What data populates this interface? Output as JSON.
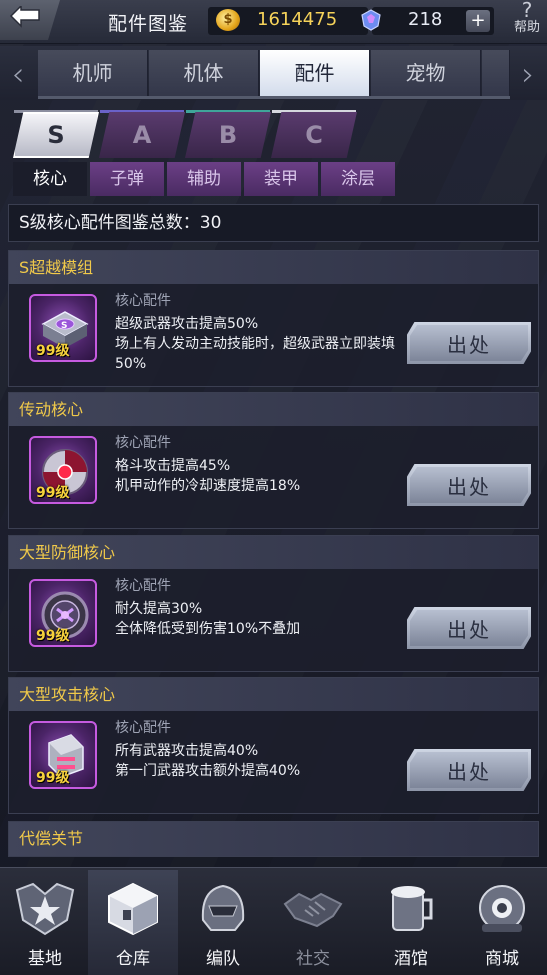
{
  "header": {
    "title": "配件图鉴",
    "gold": "1614475",
    "gems": "218",
    "plus_label": "+",
    "help_label": "帮助",
    "help_mark": "?"
  },
  "main_tabs": [
    {
      "label": "机师",
      "active": false
    },
    {
      "label": "机体",
      "active": false
    },
    {
      "label": "配件",
      "active": true
    },
    {
      "label": "宠物",
      "active": false
    }
  ],
  "grade_tabs": [
    {
      "label": "S",
      "active": true,
      "line_color": "#8c8fa0"
    },
    {
      "label": "A",
      "active": false,
      "line_color": "#6a62c9"
    },
    {
      "label": "B",
      "active": false,
      "line_color": "#3fa59a"
    },
    {
      "label": "C",
      "active": false,
      "line_color": "#d5d7de"
    }
  ],
  "sub_tabs": [
    {
      "label": "核心",
      "active": true
    },
    {
      "label": "子弹",
      "active": false
    },
    {
      "label": "辅助",
      "active": false
    },
    {
      "label": "装甲",
      "active": false
    },
    {
      "label": "涂层",
      "active": false
    }
  ],
  "total": "S级核心配件图鉴总数：30",
  "parts": [
    {
      "name": "S超越模组",
      "type": "核心配件",
      "level": "99级",
      "icon": "module-chip-icon",
      "desc": [
        "超级武器攻击提高50%",
        "场上有人发动主动技能时，超级武器立即装填",
        "50%"
      ],
      "source_label": "出处"
    },
    {
      "name": "传动核心",
      "type": "核心配件",
      "level": "99级",
      "icon": "drive-core-icon",
      "desc": [
        "格斗攻击提高45%",
        "机甲动作的冷却速度提高18%"
      ],
      "source_label": "出处"
    },
    {
      "name": "大型防御核心",
      "type": "核心配件",
      "level": "99级",
      "icon": "defense-core-icon",
      "desc": [
        "耐久提高30%",
        "全体降低受到伤害10%不叠加"
      ],
      "source_label": "出处"
    },
    {
      "name": "大型攻击核心",
      "type": "核心配件",
      "level": "99级",
      "icon": "attack-core-icon",
      "desc": [
        "所有武器攻击提高40%",
        "第一门武器攻击额外提高40%"
      ],
      "source_label": "出处"
    }
  ],
  "partial_part": {
    "name": "代偿关节"
  },
  "bottom_nav": [
    {
      "label": "基地",
      "icon": "base-star-icon",
      "active": false,
      "disabled": false
    },
    {
      "label": "仓库",
      "icon": "warehouse-cube-icon",
      "active": true,
      "disabled": false
    },
    {
      "label": "编队",
      "icon": "squad-helmet-icon",
      "active": false,
      "disabled": false
    },
    {
      "label": "社交",
      "icon": "handshake-icon",
      "active": false,
      "disabled": true
    },
    {
      "label": "酒馆",
      "icon": "tavern-mug-icon",
      "active": false,
      "disabled": false
    },
    {
      "label": "商城",
      "icon": "shop-robot-icon",
      "active": false,
      "disabled": false
    }
  ]
}
